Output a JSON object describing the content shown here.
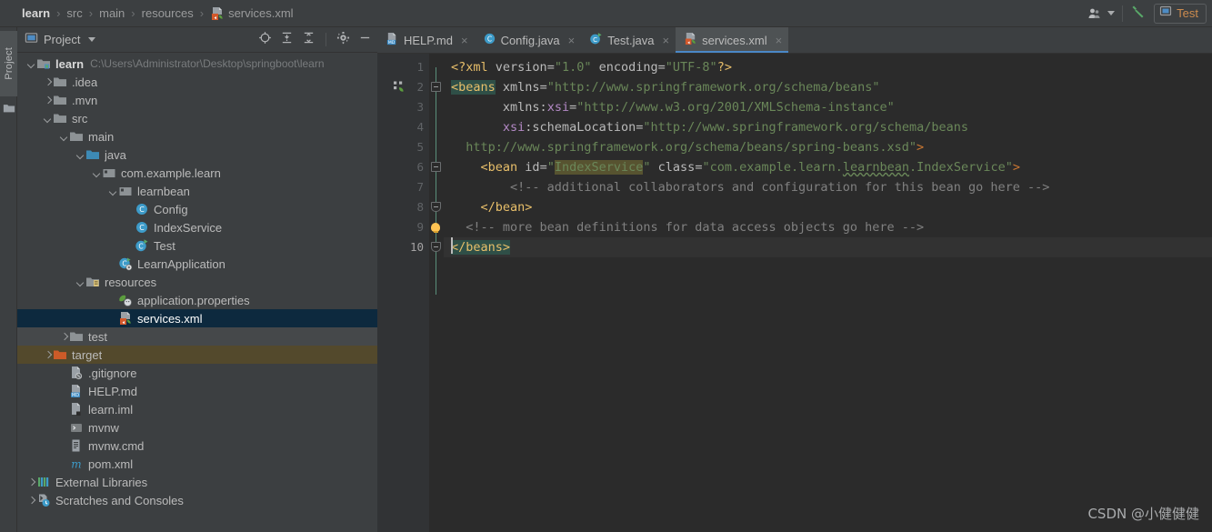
{
  "app": {
    "theme_bg": "#3c3f41",
    "editor_bg": "#2b2b2b",
    "accent": "#4a88c7",
    "selection": "#0d293e",
    "excluded": "#53492c"
  },
  "breadcrumb": {
    "separator": "›",
    "items": [
      {
        "label": "learn",
        "icon": "module-icon",
        "root": true
      },
      {
        "label": "src",
        "icon": "folder-icon"
      },
      {
        "label": "main",
        "icon": "folder-icon"
      },
      {
        "label": "resources",
        "icon": "folder-icon"
      },
      {
        "label": "services.xml",
        "icon": "xml-file-icon"
      }
    ]
  },
  "topbar_right": {
    "user_icon": "user-avatar-icon",
    "user_caret": "chevron-down-icon",
    "build_icon": "build-hammer-icon",
    "run_config": {
      "label": "Test",
      "icon": "run-config-icon",
      "color": "#cc8b4e"
    }
  },
  "tool_strip": {
    "tab_label": "Project",
    "folder_icon": "folder-icon"
  },
  "panel": {
    "title": "Project",
    "caret": "chevron-down-icon",
    "tools": [
      {
        "name": "select-opened-file-icon",
        "glyph": "crosshair"
      },
      {
        "name": "expand-all-icon",
        "glyph": "expand"
      },
      {
        "name": "collapse-all-icon",
        "glyph": "collapse"
      },
      {
        "name": "settings-gear-icon",
        "glyph": "gear"
      },
      {
        "name": "hide-panel-icon",
        "glyph": "minus"
      }
    ]
  },
  "tree": {
    "items": [
      {
        "label": "learn",
        "path": "C:\\Users\\Administrator\\Desktop\\springboot\\learn",
        "indent": 0,
        "arrow": "down",
        "icon": "module-icon",
        "bold": true
      },
      {
        "label": ".idea",
        "indent": 1,
        "arrow": "right",
        "icon": "folder-icon"
      },
      {
        "label": ".mvn",
        "indent": 1,
        "arrow": "right",
        "icon": "folder-icon"
      },
      {
        "label": "src",
        "indent": 1,
        "arrow": "down",
        "icon": "folder-icon"
      },
      {
        "label": "main",
        "indent": 2,
        "arrow": "down",
        "icon": "folder-icon"
      },
      {
        "label": "java",
        "indent": 3,
        "arrow": "down",
        "icon": "source-root-icon"
      },
      {
        "label": "com.example.learn",
        "indent": 4,
        "arrow": "down",
        "icon": "package-icon"
      },
      {
        "label": "learnbean",
        "indent": 5,
        "arrow": "down",
        "icon": "package-icon"
      },
      {
        "label": "Config",
        "indent": 6,
        "arrow": "none",
        "icon": "java-class-icon"
      },
      {
        "label": "IndexService",
        "indent": 6,
        "arrow": "none",
        "icon": "java-class-icon"
      },
      {
        "label": "Test",
        "indent": 6,
        "arrow": "none",
        "icon": "java-runnable-class-icon"
      },
      {
        "label": "LearnApplication",
        "indent": 5,
        "arrow": "none",
        "icon": "spring-boot-class-icon"
      },
      {
        "label": "resources",
        "indent": 3,
        "arrow": "down",
        "icon": "resource-root-icon"
      },
      {
        "label": "application.properties",
        "indent": 4,
        "arrow": "none",
        "icon": "spring-properties-icon"
      },
      {
        "label": "services.xml",
        "indent": 4,
        "arrow": "none",
        "icon": "spring-xml-icon",
        "selected": true
      },
      {
        "label": "test",
        "indent": 2,
        "arrow": "right",
        "icon": "test-folder-icon",
        "hovered": true
      },
      {
        "label": "target",
        "indent": 1,
        "arrow": "right",
        "icon": "excluded-folder-icon",
        "excluded": true
      },
      {
        "label": ".gitignore",
        "indent": 1,
        "arrow": "none",
        "icon": "gitignore-file-icon"
      },
      {
        "label": "HELP.md",
        "indent": 1,
        "arrow": "none",
        "icon": "markdown-file-icon"
      },
      {
        "label": "learn.iml",
        "indent": 1,
        "arrow": "none",
        "icon": "iml-file-icon"
      },
      {
        "label": "mvnw",
        "indent": 1,
        "arrow": "none",
        "icon": "shell-script-icon"
      },
      {
        "label": "mvnw.cmd",
        "indent": 1,
        "arrow": "none",
        "icon": "cmd-script-icon"
      },
      {
        "label": "pom.xml",
        "indent": 1,
        "arrow": "none",
        "icon": "maven-pom-icon"
      },
      {
        "label": "External Libraries",
        "indent": 0,
        "arrow": "right",
        "icon": "libraries-icon"
      },
      {
        "label": "Scratches and Consoles",
        "indent": 0,
        "arrow": "right",
        "icon": "scratches-icon"
      }
    ]
  },
  "editor_tabs": [
    {
      "label": "HELP.md",
      "icon": "markdown-file-icon",
      "close": "×",
      "active": false
    },
    {
      "label": "Config.java",
      "icon": "java-class-icon",
      "close": "×",
      "active": false
    },
    {
      "label": "Test.java",
      "icon": "java-runnable-class-icon",
      "close": "×",
      "active": false
    },
    {
      "label": "services.xml",
      "icon": "spring-xml-icon",
      "close": "×",
      "active": true
    }
  ],
  "code": {
    "file": "services.xml",
    "line_numbers": [
      "1",
      "2",
      "3",
      "4",
      "5",
      "6",
      "7",
      "8",
      "9",
      "10"
    ],
    "caret_line": 10,
    "gutter_bean_icon_line": 2,
    "intention_bulb_line": 9,
    "lines": [
      "<?xml version=\"1.0\" encoding=\"UTF-8\"?>",
      "<beans xmlns=\"http://www.springframework.org/schema/beans\"",
      "       xmlns:xsi=\"http://www.w3.org/2001/XMLSchema-instance\"",
      "       xsi:schemaLocation=\"http://www.springframework.org/schema/beans",
      "  http://www.springframework.org/schema/beans/spring-beans.xsd\">",
      "    <bean id=\"IndexService\" class=\"com.example.learn.learnbean.IndexService\">",
      "        <!-- additional collaborators and configuration for this bean go here -->",
      "    </bean>",
      "  <!-- more bean definitions for data access objects go here -->",
      "</beans>"
    ],
    "tokens": {
      "pi_open": "<?xml",
      "pi_close": "?>",
      "attr_version": "version",
      "val_version": "\"1.0\"",
      "attr_encoding": "encoding",
      "val_encoding": "\"UTF-8\"",
      "tag_beans_open": "<beans",
      "tag_beans_close": "</beans>",
      "attr_xmlns": "xmlns",
      "val_xmlns": "\"http://www.springframework.org/schema/beans\"",
      "attr_xsi_ns": "xsi",
      "attr_xmlns_xsi_prefix": "xmlns:",
      "val_xmlns_xsi": "\"http://www.w3.org/2001/XMLSchema-instance\"",
      "attr_schema_location": ":schemaLocation",
      "val_schema_1": "\"http://www.springframework.org/schema/beans",
      "val_schema_2": "  http://www.springframework.org/schema/beans/spring-beans.xsd\"",
      "tag_bean_open": "<bean",
      "attr_id": "id",
      "val_id": "IndexService",
      "attr_class": "class",
      "val_class_pre": "\"com.example.learn.",
      "val_class_squiggle": "learnbean",
      "val_class_post": ".IndexService\"",
      "tag_bean_close": "</bean>",
      "comment_1": "<!-- additional collaborators and configuration for this bean go here -->",
      "comment_2": "<!-- more bean definitions for data access objects go here -->",
      "gt": ">",
      "eq": "=",
      "quote": "\""
    }
  },
  "watermark": "CSDN @小健健健"
}
